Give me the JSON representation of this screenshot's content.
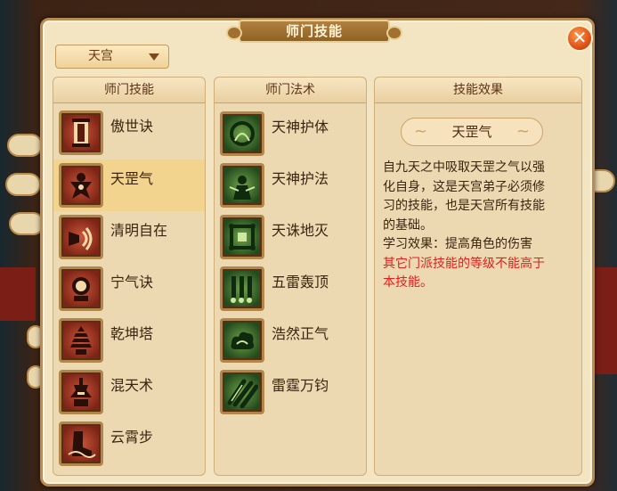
{
  "window": {
    "title": "师门技能",
    "close_icon": "close-icon"
  },
  "sect_selector": {
    "selected": "天宫"
  },
  "columns": {
    "skills": {
      "header": "师门技能",
      "items": [
        {
          "name": "傲世诀",
          "icon": "scroll-icon"
        },
        {
          "name": "天罡气",
          "icon": "warrior-icon",
          "selected": true
        },
        {
          "name": "清明自在",
          "icon": "horn-icon"
        },
        {
          "name": "宁气诀",
          "icon": "mirror-icon"
        },
        {
          "name": "乾坤塔",
          "icon": "pagoda-icon"
        },
        {
          "name": "混天术",
          "icon": "urn-icon"
        },
        {
          "name": "云霄步",
          "icon": "boot-icon"
        }
      ]
    },
    "spells": {
      "header": "师门法术",
      "items": [
        {
          "name": "天神护体",
          "icon": "halo-shield-icon"
        },
        {
          "name": "天神护法",
          "icon": "guardian-icon"
        },
        {
          "name": "天诛地灭",
          "icon": "frame-seal-icon"
        },
        {
          "name": "五雷轰顶",
          "icon": "thunder-columns-icon"
        },
        {
          "name": "浩然正气",
          "icon": "cloud-swirl-icon"
        },
        {
          "name": "雷霆万钧",
          "icon": "claw-strike-icon"
        }
      ]
    },
    "effect": {
      "header": "技能效果",
      "skill_name": "天罡气",
      "lines": [
        "自九天之中吸取天罡之气以强",
        "化自身，这是天宫弟子必须修",
        "习的技能，也是天宫所有技能",
        "的基础。",
        "学习效果：提高角色的伤害"
      ],
      "warning_lines": [
        "其它门派技能的等级不能高于",
        "本技能。"
      ]
    }
  },
  "colors": {
    "warning": "#e41d1d",
    "panel": "#f3e4c2",
    "selected_row": "#f2d48e"
  }
}
